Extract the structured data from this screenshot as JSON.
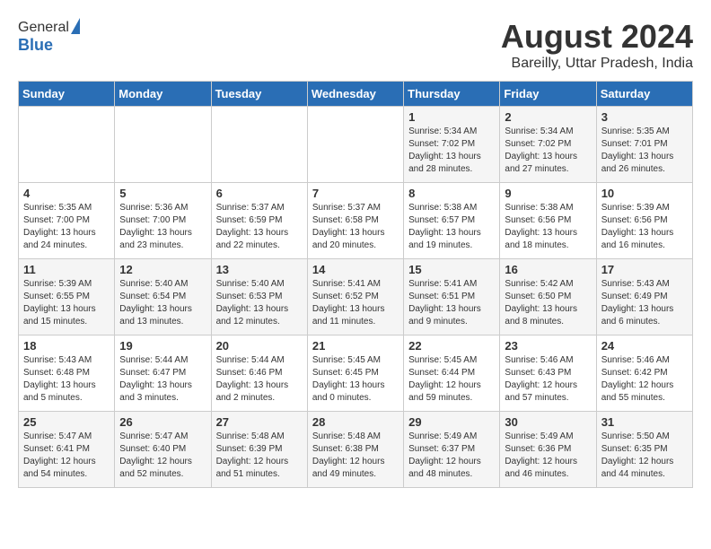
{
  "header": {
    "logo_general": "General",
    "logo_blue": "Blue",
    "month_title": "August 2024",
    "location": "Bareilly, Uttar Pradesh, India"
  },
  "days_of_week": [
    "Sunday",
    "Monday",
    "Tuesday",
    "Wednesday",
    "Thursday",
    "Friday",
    "Saturday"
  ],
  "weeks": [
    [
      {
        "day": "",
        "sunrise": "",
        "sunset": "",
        "daylight": ""
      },
      {
        "day": "",
        "sunrise": "",
        "sunset": "",
        "daylight": ""
      },
      {
        "day": "",
        "sunrise": "",
        "sunset": "",
        "daylight": ""
      },
      {
        "day": "",
        "sunrise": "",
        "sunset": "",
        "daylight": ""
      },
      {
        "day": "1",
        "sunrise": "Sunrise: 5:34 AM",
        "sunset": "Sunset: 7:02 PM",
        "daylight": "Daylight: 13 hours and 28 minutes."
      },
      {
        "day": "2",
        "sunrise": "Sunrise: 5:34 AM",
        "sunset": "Sunset: 7:02 PM",
        "daylight": "Daylight: 13 hours and 27 minutes."
      },
      {
        "day": "3",
        "sunrise": "Sunrise: 5:35 AM",
        "sunset": "Sunset: 7:01 PM",
        "daylight": "Daylight: 13 hours and 26 minutes."
      }
    ],
    [
      {
        "day": "4",
        "sunrise": "Sunrise: 5:35 AM",
        "sunset": "Sunset: 7:00 PM",
        "daylight": "Daylight: 13 hours and 24 minutes."
      },
      {
        "day": "5",
        "sunrise": "Sunrise: 5:36 AM",
        "sunset": "Sunset: 7:00 PM",
        "daylight": "Daylight: 13 hours and 23 minutes."
      },
      {
        "day": "6",
        "sunrise": "Sunrise: 5:37 AM",
        "sunset": "Sunset: 6:59 PM",
        "daylight": "Daylight: 13 hours and 22 minutes."
      },
      {
        "day": "7",
        "sunrise": "Sunrise: 5:37 AM",
        "sunset": "Sunset: 6:58 PM",
        "daylight": "Daylight: 13 hours and 20 minutes."
      },
      {
        "day": "8",
        "sunrise": "Sunrise: 5:38 AM",
        "sunset": "Sunset: 6:57 PM",
        "daylight": "Daylight: 13 hours and 19 minutes."
      },
      {
        "day": "9",
        "sunrise": "Sunrise: 5:38 AM",
        "sunset": "Sunset: 6:56 PM",
        "daylight": "Daylight: 13 hours and 18 minutes."
      },
      {
        "day": "10",
        "sunrise": "Sunrise: 5:39 AM",
        "sunset": "Sunset: 6:56 PM",
        "daylight": "Daylight: 13 hours and 16 minutes."
      }
    ],
    [
      {
        "day": "11",
        "sunrise": "Sunrise: 5:39 AM",
        "sunset": "Sunset: 6:55 PM",
        "daylight": "Daylight: 13 hours and 15 minutes."
      },
      {
        "day": "12",
        "sunrise": "Sunrise: 5:40 AM",
        "sunset": "Sunset: 6:54 PM",
        "daylight": "Daylight: 13 hours and 13 minutes."
      },
      {
        "day": "13",
        "sunrise": "Sunrise: 5:40 AM",
        "sunset": "Sunset: 6:53 PM",
        "daylight": "Daylight: 13 hours and 12 minutes."
      },
      {
        "day": "14",
        "sunrise": "Sunrise: 5:41 AM",
        "sunset": "Sunset: 6:52 PM",
        "daylight": "Daylight: 13 hours and 11 minutes."
      },
      {
        "day": "15",
        "sunrise": "Sunrise: 5:41 AM",
        "sunset": "Sunset: 6:51 PM",
        "daylight": "Daylight: 13 hours and 9 minutes."
      },
      {
        "day": "16",
        "sunrise": "Sunrise: 5:42 AM",
        "sunset": "Sunset: 6:50 PM",
        "daylight": "Daylight: 13 hours and 8 minutes."
      },
      {
        "day": "17",
        "sunrise": "Sunrise: 5:43 AM",
        "sunset": "Sunset: 6:49 PM",
        "daylight": "Daylight: 13 hours and 6 minutes."
      }
    ],
    [
      {
        "day": "18",
        "sunrise": "Sunrise: 5:43 AM",
        "sunset": "Sunset: 6:48 PM",
        "daylight": "Daylight: 13 hours and 5 minutes."
      },
      {
        "day": "19",
        "sunrise": "Sunrise: 5:44 AM",
        "sunset": "Sunset: 6:47 PM",
        "daylight": "Daylight: 13 hours and 3 minutes."
      },
      {
        "day": "20",
        "sunrise": "Sunrise: 5:44 AM",
        "sunset": "Sunset: 6:46 PM",
        "daylight": "Daylight: 13 hours and 2 minutes."
      },
      {
        "day": "21",
        "sunrise": "Sunrise: 5:45 AM",
        "sunset": "Sunset: 6:45 PM",
        "daylight": "Daylight: 13 hours and 0 minutes."
      },
      {
        "day": "22",
        "sunrise": "Sunrise: 5:45 AM",
        "sunset": "Sunset: 6:44 PM",
        "daylight": "Daylight: 12 hours and 59 minutes."
      },
      {
        "day": "23",
        "sunrise": "Sunrise: 5:46 AM",
        "sunset": "Sunset: 6:43 PM",
        "daylight": "Daylight: 12 hours and 57 minutes."
      },
      {
        "day": "24",
        "sunrise": "Sunrise: 5:46 AM",
        "sunset": "Sunset: 6:42 PM",
        "daylight": "Daylight: 12 hours and 55 minutes."
      }
    ],
    [
      {
        "day": "25",
        "sunrise": "Sunrise: 5:47 AM",
        "sunset": "Sunset: 6:41 PM",
        "daylight": "Daylight: 12 hours and 54 minutes."
      },
      {
        "day": "26",
        "sunrise": "Sunrise: 5:47 AM",
        "sunset": "Sunset: 6:40 PM",
        "daylight": "Daylight: 12 hours and 52 minutes."
      },
      {
        "day": "27",
        "sunrise": "Sunrise: 5:48 AM",
        "sunset": "Sunset: 6:39 PM",
        "daylight": "Daylight: 12 hours and 51 minutes."
      },
      {
        "day": "28",
        "sunrise": "Sunrise: 5:48 AM",
        "sunset": "Sunset: 6:38 PM",
        "daylight": "Daylight: 12 hours and 49 minutes."
      },
      {
        "day": "29",
        "sunrise": "Sunrise: 5:49 AM",
        "sunset": "Sunset: 6:37 PM",
        "daylight": "Daylight: 12 hours and 48 minutes."
      },
      {
        "day": "30",
        "sunrise": "Sunrise: 5:49 AM",
        "sunset": "Sunset: 6:36 PM",
        "daylight": "Daylight: 12 hours and 46 minutes."
      },
      {
        "day": "31",
        "sunrise": "Sunrise: 5:50 AM",
        "sunset": "Sunset: 6:35 PM",
        "daylight": "Daylight: 12 hours and 44 minutes."
      }
    ]
  ]
}
